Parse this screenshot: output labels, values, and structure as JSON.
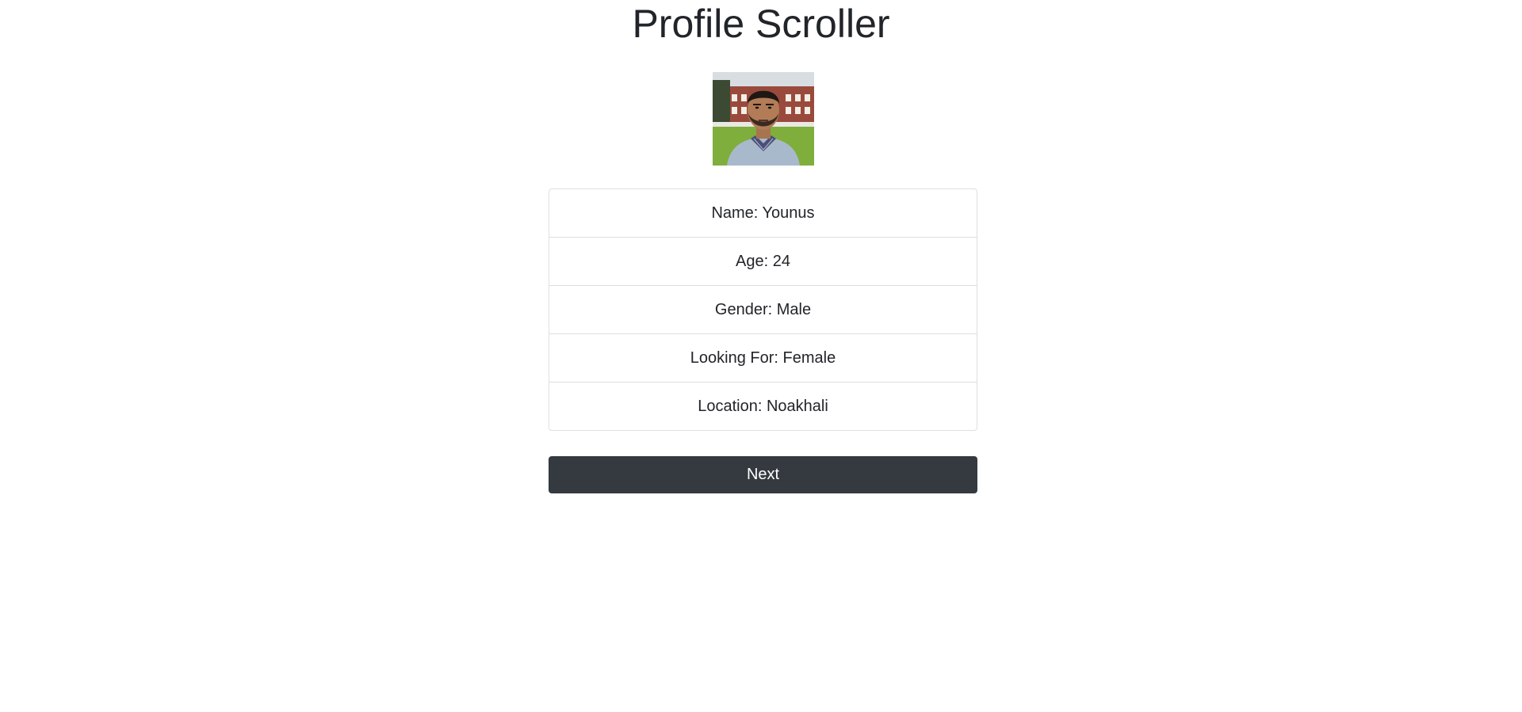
{
  "page": {
    "title": "Profile Scroller"
  },
  "profile": {
    "avatar_alt": "profile photo",
    "fields": [
      "Name: Younus",
      "Age: 24",
      "Gender: Male",
      "Looking For: Female",
      "Location: Noakhali"
    ]
  },
  "actions": {
    "next_label": "Next"
  },
  "colors": {
    "button_bg": "#343a40",
    "border": "#dfdfdf",
    "text": "#212529"
  }
}
